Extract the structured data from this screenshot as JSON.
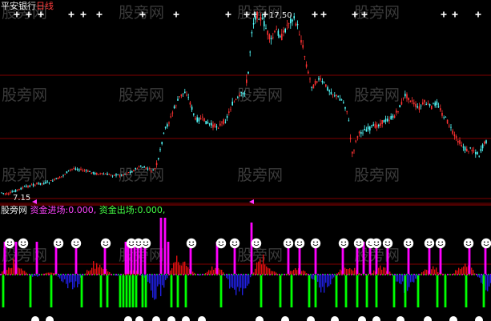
{
  "main_panel": {
    "security_name": "平安银行",
    "period": "日线",
    "high_label": "17.50",
    "low_label": "7.15"
  },
  "indicator_panel": {
    "source_label": "股旁网",
    "inflow_label": "资金进场:",
    "inflow_value": "0.000,",
    "outflow_label": "资金出场:",
    "outflow_value": "0.000,"
  },
  "watermark": {
    "text": "股旁网"
  },
  "colors": {
    "background": "#000000",
    "rise": "#ff3232",
    "fall": "#54ffff",
    "grid": "#800000",
    "inflow": "#ff00ff",
    "outflow": "#00ff00",
    "smiley": "#ffffff"
  },
  "icons": {
    "top_marker": "star-icon",
    "indicator_signal": "smiley-face-icon",
    "axis_marker": "triangle-left-icon"
  }
}
